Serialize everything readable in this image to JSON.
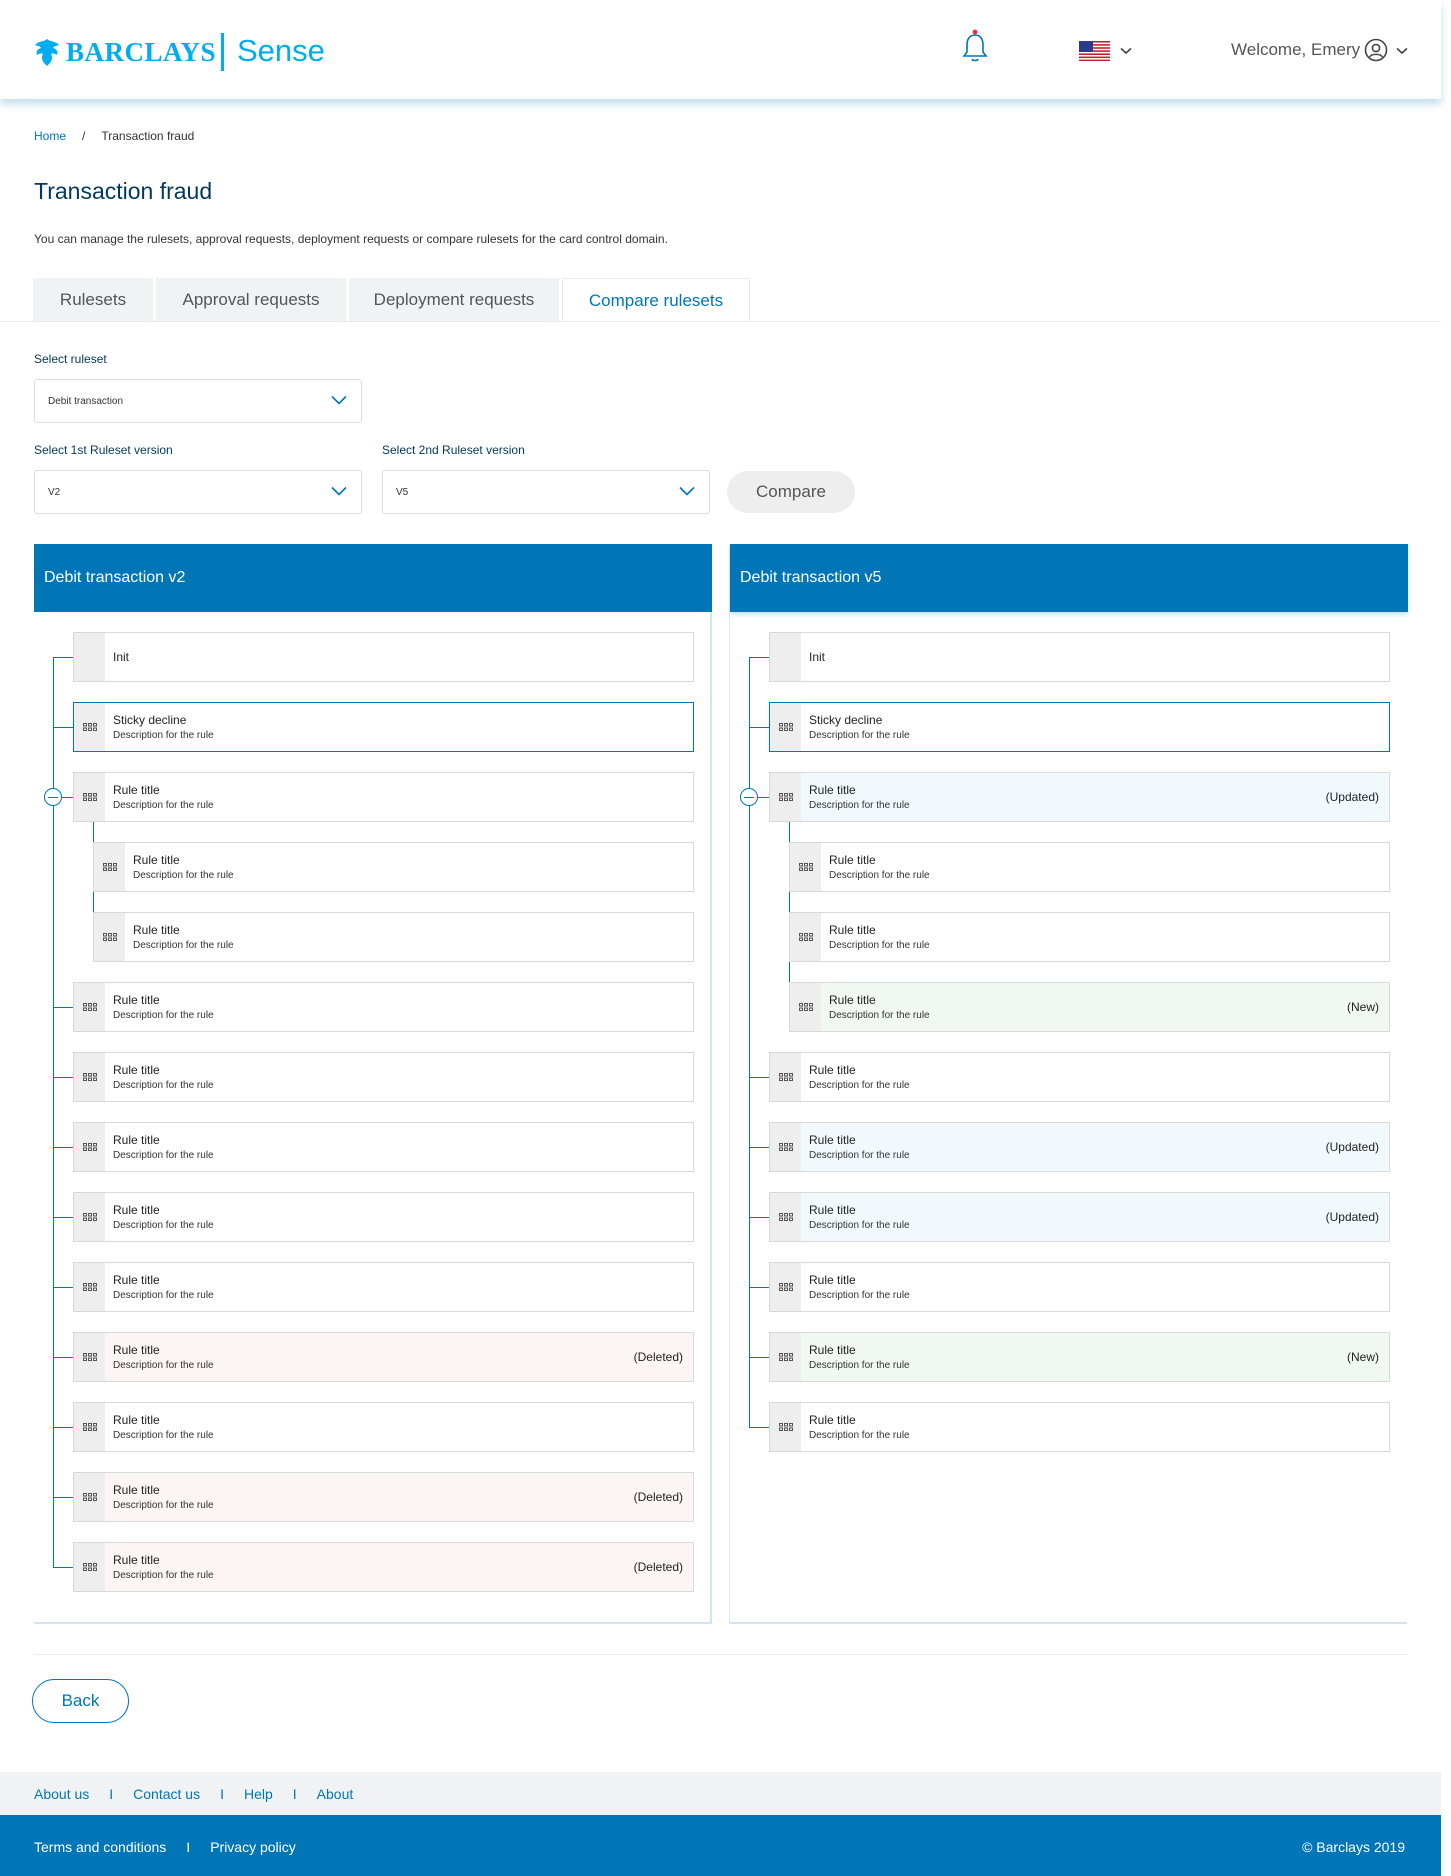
{
  "header": {
    "brand": "BARCLAYS",
    "product": "Sense",
    "welcome": "Welcome, Emery"
  },
  "breadcrumb": {
    "home": "Home",
    "separator": "/",
    "current": "Transaction fraud"
  },
  "page": {
    "title": "Transaction fraud",
    "description": "You can manage the rulesets, approval requests, deployment requests or compare rulesets for the card control domain."
  },
  "tabs": [
    "Rulesets",
    "Approval requests",
    "Deployment requests",
    "Compare rulesets"
  ],
  "form": {
    "ruleset_label": "Select ruleset",
    "ruleset_value": "Debit transaction",
    "v1_label": "Select 1st Ruleset version",
    "v1_value": "V2",
    "v2_label": "Select 2nd Ruleset version",
    "v2_value": "V5",
    "compare_label": "Compare"
  },
  "left_panel": {
    "title": "Debit transaction v2",
    "rules": [
      {
        "title": "Init",
        "desc": "",
        "status": ""
      },
      {
        "title": "Sticky decline",
        "desc": "Description for the rule",
        "status": ""
      },
      {
        "title": "Rule title",
        "desc": "Description for the rule",
        "status": ""
      },
      {
        "title": "Rule title",
        "desc": "Description for the rule",
        "status": ""
      },
      {
        "title": "Rule title",
        "desc": "Description for the rule",
        "status": ""
      },
      {
        "title": "Rule title",
        "desc": "Description for the rule",
        "status": ""
      },
      {
        "title": "Rule title",
        "desc": "Description for the rule",
        "status": ""
      },
      {
        "title": "Rule title",
        "desc": "Description for the rule",
        "status": ""
      },
      {
        "title": "Rule title",
        "desc": "Description for the rule",
        "status": ""
      },
      {
        "title": "Rule title",
        "desc": "Description for the rule",
        "status": ""
      },
      {
        "title": "Rule title",
        "desc": "Description for the rule",
        "status": "(Deleted)"
      },
      {
        "title": "Rule title",
        "desc": "Description for the rule",
        "status": ""
      },
      {
        "title": "Rule title",
        "desc": "Description for the rule",
        "status": "(Deleted)"
      },
      {
        "title": "Rule title",
        "desc": "Description for the rule",
        "status": "(Deleted)"
      }
    ]
  },
  "right_panel": {
    "title": "Debit transaction v5",
    "rules": [
      {
        "title": "Init",
        "desc": "",
        "status": ""
      },
      {
        "title": "Sticky decline",
        "desc": "Description for the rule",
        "status": ""
      },
      {
        "title": "Rule title",
        "desc": "Description for the rule",
        "status": "(Updated)"
      },
      {
        "title": "Rule title",
        "desc": "Description for the rule",
        "status": ""
      },
      {
        "title": "Rule title",
        "desc": "Description for the rule",
        "status": ""
      },
      {
        "title": "Rule title",
        "desc": "Description for the rule",
        "status": "(New)"
      },
      {
        "title": "Rule title",
        "desc": "Description for the rule",
        "status": ""
      },
      {
        "title": "Rule title",
        "desc": "Description for the rule",
        "status": "(Updated)"
      },
      {
        "title": "Rule title",
        "desc": "Description for the rule",
        "status": "(Updated)"
      },
      {
        "title": "Rule title",
        "desc": "Description for the rule",
        "status": ""
      },
      {
        "title": "Rule title",
        "desc": "Description for the rule",
        "status": "(New)"
      },
      {
        "title": "Rule title",
        "desc": "Description for the rule",
        "status": ""
      }
    ]
  },
  "back_label": "Back",
  "footer": {
    "links": [
      "About us",
      "Contact us",
      "Help",
      "About"
    ],
    "separator": "I",
    "terms": "Terms and conditions",
    "privacy": "Privacy policy",
    "copyright": "© Barclays 2019"
  },
  "colors": {
    "brand_blue": "#0076b6",
    "logo_cyan": "#00aeef",
    "heading_navy": "#00395d",
    "deleted_bg": "#fbf5f4",
    "updated_bg": "#f2f9fc",
    "new_bg": "#f1f8f2"
  },
  "icons": [
    "eagle-logo-icon",
    "bell-icon",
    "us-flag-icon",
    "chevron-down-icon",
    "user-circle-icon",
    "drag-handle-icon",
    "collapse-minus-icon"
  ]
}
